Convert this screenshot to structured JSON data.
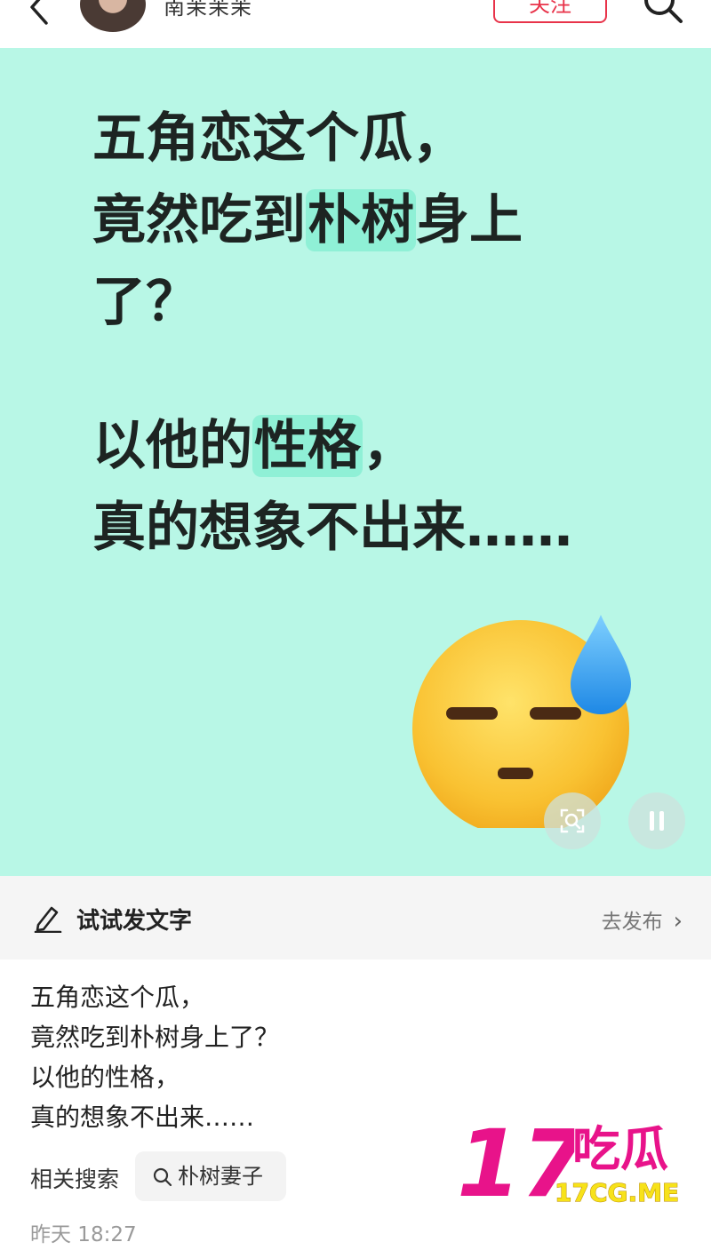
{
  "header": {
    "username": "南茉茉茉",
    "follow_label": "关注"
  },
  "post_image": {
    "lines": [
      [
        {
          "t": "五角恋这个瓜，"
        }
      ],
      [
        {
          "t": "竟然吃到"
        },
        {
          "t": "朴树",
          "hl": true
        },
        {
          "t": "身上"
        }
      ],
      [
        {
          "t": "了？"
        }
      ],
      [],
      [
        {
          "t": "以他的"
        },
        {
          "t": "性格",
          "hl": true
        },
        {
          "t": "，"
        }
      ],
      [
        {
          "t": "真的想象不出来……"
        }
      ]
    ],
    "emoji": "downcast-face-with-sweat",
    "background_color": "#b8f7e6",
    "highlight_color": "#8ff0d6"
  },
  "try_bar": {
    "label": "试试发文字",
    "publish_label": "去发布"
  },
  "caption": {
    "line1": "五角恋这个瓜，",
    "line2": "竟然吃到朴树身上了？",
    "line3": "以他的性格，",
    "line4": "真的想象不出来……"
  },
  "related": {
    "label": "相关搜索",
    "chip": "朴树妻子"
  },
  "timestamp": "昨天 18:27",
  "watermark": {
    "number": "17",
    "text": "吃瓜",
    "domain": "17CG.ME"
  }
}
